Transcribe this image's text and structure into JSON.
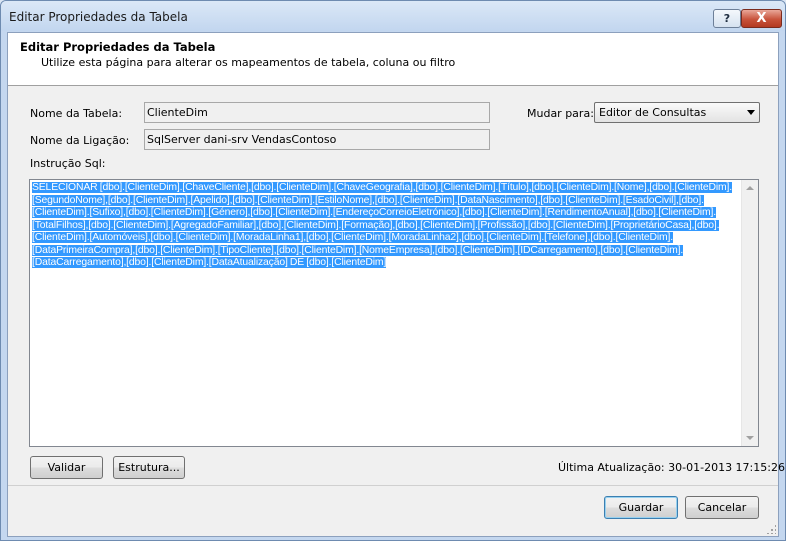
{
  "window": {
    "title": "Editar Propriedades da Tabela",
    "help_label": "?",
    "close_label": "X"
  },
  "header": {
    "title": "Editar Propriedades da Tabela",
    "subtitle": "Utilize esta página para alterar os mapeamentos de tabela, coluna ou filtro"
  },
  "form": {
    "table_name_label": "Nome da Tabela:",
    "table_name_value": "ClienteDim",
    "connection_label": "Nome da Ligação:",
    "connection_value": "SqlServer dani-srv VendasContoso",
    "switch_to_label": "Mudar para:",
    "switch_to_value": "Editor de Consultas",
    "sql_label": "Instrução Sql:",
    "sql_text": "SELECIONAR [dbo].[ClienteDim].[ChaveCliente],[dbo].[ClienteDim].[ChaveGeografia],[dbo].[ClienteDim].[Título],[dbo].[ClienteDim].[Nome],[dbo].[ClienteDim].[SegundoNome],[dbo].[ClienteDim].[Apelido],[dbo].[ClienteDim].[EstiloNome],[dbo].[ClienteDim].[DataNascimento],[dbo].[ClienteDim].[EsadoCivil],[dbo].[ClienteDim].[Sufixo],[dbo].[ClienteDim].[Género],[dbo].[ClienteDim].[EndereçoCorreioEletrónico],[dbo].[ClienteDim].[RendimentoAnual],[dbo].[ClienteDim].[TotalFilhos],[dbo].[ClienteDim].[AgregadoFamiliar],[dbo].[ClienteDim].[Formação],[dbo].[ClienteDim].[Profissão],[dbo].[ClienteDim].[ProprietárioCasa],[dbo].[ClienteDim].[Automóveis],[dbo].[ClienteDim].[MoradaLinha1],[dbo].[ClienteDim].[MoradaLinha2],[dbo].[ClienteDim].[Telefone],[dbo].[ClienteDim].[DataPrimeiraCompra],[dbo].[ClienteDim].[TipoCliente],[dbo].[ClienteDim].[NomeEmpresa],[dbo].[ClienteDim].[IDCarregamento],[dbo].[ClienteDim].[DataCarregamento],[dbo].[ClienteDim].[DataAtualização]                              DE [dbo].[ClienteDim]"
  },
  "buttons": {
    "validate": "Validar",
    "structure": "Estrutura...",
    "save": "Guardar",
    "cancel": "Cancelar"
  },
  "status": {
    "last_update": "Última Atualização: 30-01-2013 17:15:26"
  }
}
